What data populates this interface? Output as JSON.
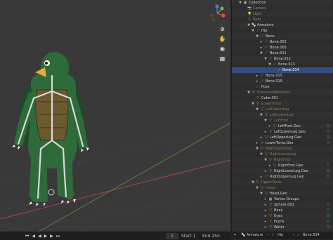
{
  "timeline": {
    "controls": [
      "⏮",
      "◀",
      "◀",
      "▶",
      "▶",
      "⏭"
    ],
    "current_frame": "1",
    "start_label": "Start",
    "start_value": "1",
    "end_label": "End",
    "end_value": "250"
  },
  "outliner_rows": [
    {
      "label": "Collection",
      "depth": 0,
      "arrow": "▼",
      "icon": "▣",
      "color": "#cfcfcf",
      "bg": "#303030"
    },
    {
      "label": "Camera",
      "depth": 1,
      "arrow": "",
      "icon": "📷",
      "color": "#8a8a8a",
      "bg": "#2d2d2d"
    },
    {
      "label": "Light",
      "depth": 1,
      "arrow": "",
      "icon": "💡",
      "color": "#8a8a8a",
      "bg": "#303030"
    },
    {
      "label": "Root",
      "depth": 1,
      "arrow": "",
      "icon": "▽",
      "color": "#8a8a8a",
      "bg": "#2d2d2d"
    },
    {
      "label": "Armature",
      "depth": 2,
      "arrow": "▼",
      "icon": "🦴",
      "color": "#cfcfcf",
      "bg": "#303030"
    },
    {
      "label": "Hip",
      "depth": 3,
      "arrow": "▼",
      "icon": "⟋",
      "color": "#cfcfcf",
      "bg": "#2d2d2d"
    },
    {
      "label": "Bone",
      "depth": 4,
      "arrow": "▼",
      "icon": "⟋",
      "color": "#cfcfcf",
      "bg": "#303030"
    },
    {
      "label": "Bone.002",
      "depth": 5,
      "arrow": "▸",
      "icon": "⟋",
      "color": "#cfcfcf",
      "bg": "#2d2d2d"
    },
    {
      "label": "Bone.005",
      "depth": 5,
      "arrow": "▸",
      "icon": "⟋",
      "color": "#cfcfcf",
      "bg": "#303030"
    },
    {
      "label": "Bone.011",
      "depth": 5,
      "arrow": "▼",
      "icon": "⟋",
      "color": "#cfcfcf",
      "bg": "#2d2d2d"
    },
    {
      "label": "Bone.012",
      "depth": 6,
      "arrow": "▼",
      "icon": "⟋",
      "color": "#cfcfcf",
      "bg": "#303030"
    },
    {
      "label": "Bone.013",
      "depth": 7,
      "arrow": "▼",
      "icon": "⟋",
      "color": "#cfcfcf",
      "bg": "#2d2d2d"
    },
    {
      "label": "Bone.014",
      "depth": 8,
      "arrow": "",
      "icon": "⟋",
      "color": "#ffffff",
      "bg": "#334d80",
      "selected": true
    },
    {
      "label": "Bone.015",
      "depth": 4,
      "arrow": "▸",
      "icon": "⟋",
      "color": "#cfcfcf",
      "bg": "#2d2d2d"
    },
    {
      "label": "Bone.019",
      "depth": 4,
      "arrow": "▸",
      "icon": "⟋",
      "color": "#cfcfcf",
      "bg": "#303030"
    },
    {
      "label": "Pose",
      "depth": 3,
      "arrow": "",
      "icon": "⟋",
      "color": "#cfcfcf",
      "bg": "#2d2d2d"
    },
    {
      "label": "HumanoidRootPart",
      "depth": 2,
      "arrow": "▼",
      "icon": "▽",
      "color": "#8a7a5a",
      "bg": "#303030"
    },
    {
      "label": "Cube.001",
      "depth": 3,
      "arrow": "",
      "icon": "▽",
      "color": "#cfcfcf",
      "bg": "#2d2d2d"
    },
    {
      "label": "LowerTorso",
      "depth": 3,
      "arrow": "▼",
      "icon": "▽",
      "color": "#8a7a5a",
      "bg": "#303030"
    },
    {
      "label": "LeftUpperLeg",
      "depth": 4,
      "arrow": "▼",
      "icon": "▽",
      "color": "#8a7a5a",
      "bg": "#2d2d2d"
    },
    {
      "label": "LeftLowerLeg",
      "depth": 5,
      "arrow": "▼",
      "icon": "▽",
      "color": "#8a7a5a",
      "bg": "#303030"
    },
    {
      "label": "LeftFoot",
      "depth": 6,
      "arrow": "▼",
      "icon": "▽",
      "color": "#8a7a5a",
      "bg": "#2d2d2d"
    },
    {
      "label": "LeftFoot.Geo",
      "depth": 7,
      "arrow": "▸",
      "icon": "▽",
      "color": "#cfcfcf",
      "bg": "#303030",
      "right": "green"
    },
    {
      "label": "LeftLowerLeg.Geo",
      "depth": 6,
      "arrow": "▸",
      "icon": "▽",
      "color": "#cfcfcf",
      "bg": "#2d2d2d",
      "right": "green"
    },
    {
      "label": "LeftUpperLeg.Geo",
      "depth": 5,
      "arrow": "▸",
      "icon": "▽",
      "color": "#cfcfcf",
      "bg": "#303030",
      "right": "green"
    },
    {
      "label": "LowerTorso.Geo",
      "depth": 4,
      "arrow": "▸",
      "icon": "▽",
      "color": "#cfcfcf",
      "bg": "#2d2d2d",
      "right": "green"
    },
    {
      "label": "RightUpperLeg",
      "depth": 4,
      "arrow": "▼",
      "icon": "▽",
      "color": "#8a7a5a",
      "bg": "#303030"
    },
    {
      "label": "RightLowerLeg",
      "depth": 5,
      "arrow": "▼",
      "icon": "▽",
      "color": "#8a7a5a",
      "bg": "#2d2d2d"
    },
    {
      "label": "RightFoot",
      "depth": 6,
      "arrow": "▼",
      "icon": "▽",
      "color": "#8a7a5a",
      "bg": "#303030"
    },
    {
      "label": "RightFoot.Geo",
      "depth": 7,
      "arrow": "▸",
      "icon": "▽",
      "color": "#cfcfcf",
      "bg": "#2d2d2d",
      "right": "green"
    },
    {
      "label": "RightLowerLeg.Geo",
      "depth": 6,
      "arrow": "▸",
      "icon": "▽",
      "color": "#cfcfcf",
      "bg": "#303030",
      "right": "green"
    },
    {
      "label": "RightUpperLeg.Geo",
      "depth": 5,
      "arrow": "▸",
      "icon": "▽",
      "color": "#cfcfcf",
      "bg": "#2d2d2d",
      "right": "green"
    },
    {
      "label": "UpperTorso",
      "depth": 3,
      "arrow": "▼",
      "icon": "▽",
      "color": "#8a7a5a",
      "bg": "#303030"
    },
    {
      "label": "Head",
      "depth": 4,
      "arrow": "▼",
      "icon": "▽",
      "color": "#8a7a5a",
      "bg": "#2d2d2d"
    },
    {
      "label": "Head.Geo",
      "depth": 5,
      "arrow": "▼",
      "icon": "▽",
      "color": "#cfcfcf",
      "bg": "#303030"
    },
    {
      "label": "Vertex Groups",
      "depth": 6,
      "arrow": "▸",
      "icon": "▦",
      "color": "#cfcfcf",
      "bg": "#2d2d2d"
    },
    {
      "label": "Sphere.001",
      "depth": 6,
      "arrow": "▸",
      "icon": "▽",
      "color": "#cfcfcf",
      "bg": "#303030",
      "right": "green"
    },
    {
      "label": "Beak",
      "depth": 6,
      "arrow": "▸",
      "icon": "▽",
      "color": "#cfcfcf",
      "bg": "#2d2d2d",
      "right": "green"
    },
    {
      "label": "Eyes",
      "depth": 6,
      "arrow": "▸",
      "icon": "▽",
      "color": "#cfcfcf",
      "bg": "#303030",
      "right": "green"
    },
    {
      "label": "Pupils",
      "depth": 6,
      "arrow": "▸",
      "icon": "▽",
      "color": "#cfcfcf",
      "bg": "#2d2d2d",
      "right": "green"
    },
    {
      "label": "Water",
      "depth": 6,
      "arrow": "▸",
      "icon": "▽",
      "color": "#cfcfcf",
      "bg": "#303030",
      "right": "green"
    }
  ],
  "status": {
    "armature_label": "Armature",
    "hip_label": "Hip",
    "bone_label": "Bone.014"
  },
  "colors": {
    "selected_row": "#334d80",
    "accent_orange": "#e8933a",
    "turtle_green": "#2e6b3a",
    "bone_white": "#d8d8d8"
  }
}
